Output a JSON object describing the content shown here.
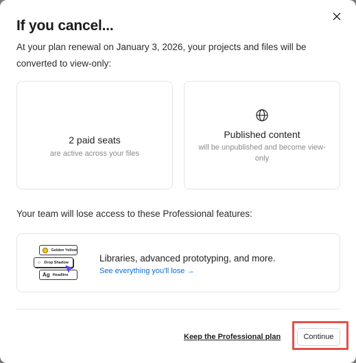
{
  "dialog": {
    "title": "If you cancel...",
    "subtitle": "At your plan renewal on January 3, 2026, your projects and files will be converted to view-only:"
  },
  "cards": {
    "seats": {
      "heading": "2 paid seats",
      "description": "are active across your files"
    },
    "published": {
      "icon": "globe-icon",
      "heading": "Published content",
      "description": "will be unpublished and become view-only"
    }
  },
  "features": {
    "label": "Your team will lose access to these Professional features:",
    "headline": "Libraries, advanced prototyping, and more.",
    "link": "See everything you'll lose →",
    "illustration": {
      "pill1": "Golden Yellow",
      "pill2": "Drop Shadow",
      "pill3": "Headline",
      "glyph": "Ag"
    }
  },
  "footer": {
    "keep_label": "Keep the Professional plan",
    "continue_label": "Continue"
  },
  "colors": {
    "link": "#0d6bd8",
    "highlight": "#e0504a",
    "swatch_yellow": "#f2c81c"
  }
}
